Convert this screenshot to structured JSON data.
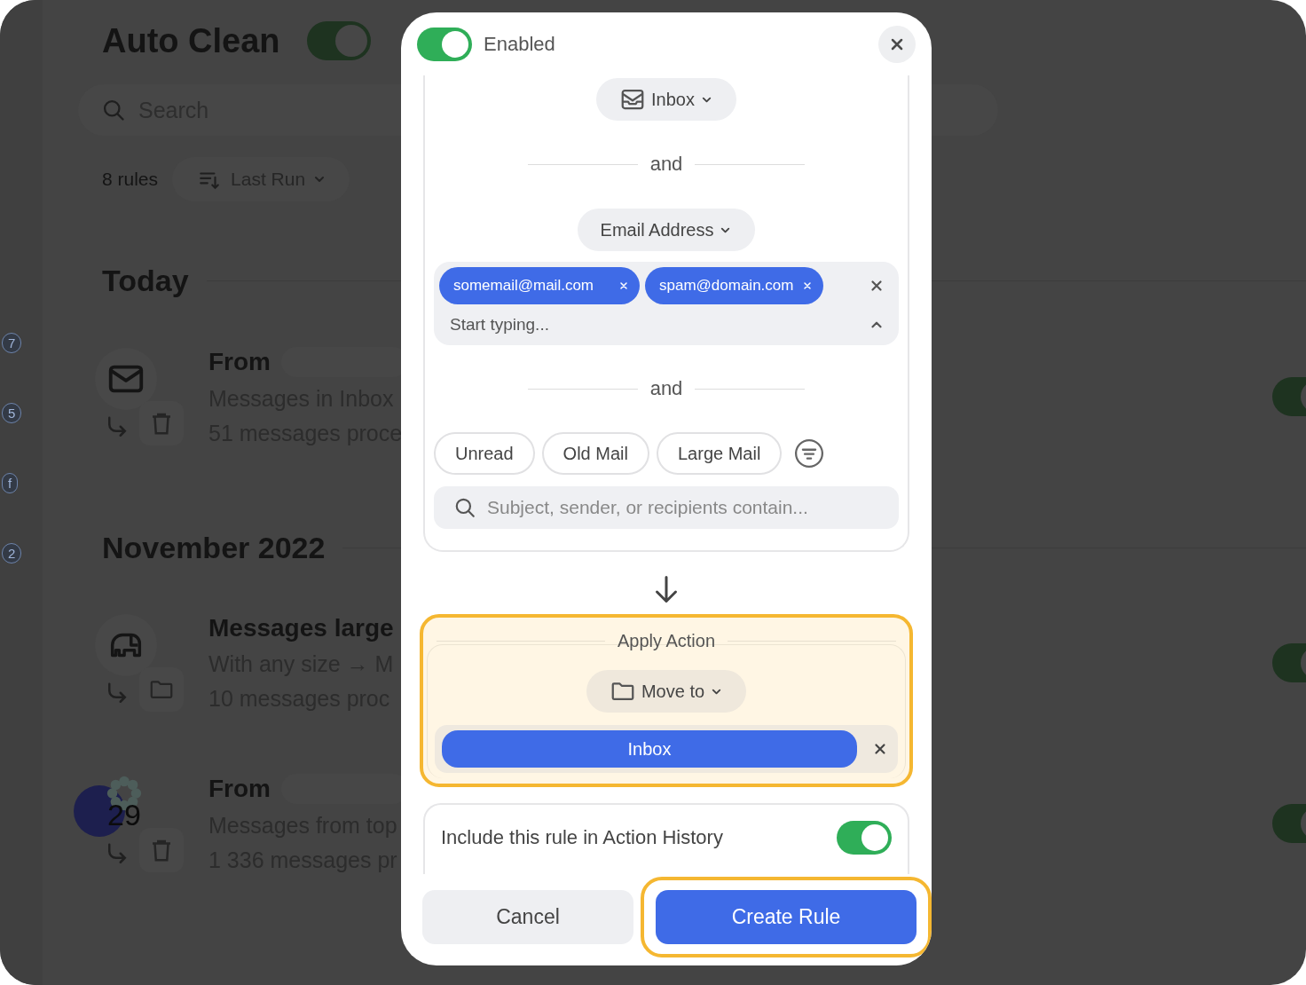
{
  "app": {
    "title": "Auto Clean",
    "enabled": true,
    "search": {
      "placeholder": "Search"
    },
    "rule_count": "8 rules",
    "sort": {
      "label": "Last Run"
    },
    "sidebar_badges": [
      "7",
      "5",
      "f",
      "2"
    ],
    "sections": [
      {
        "heading": "Today",
        "rules": [
          {
            "kind": "inbox-delete",
            "title": "From",
            "redacted": true,
            "description": "Messages in Inbox",
            "stats": "51 messages proce",
            "enabled": true
          }
        ]
      },
      {
        "heading": "November 2022",
        "rules": [
          {
            "kind": "large-move",
            "title": "Messages large",
            "redacted": false,
            "description": "With any size → M",
            "stats": "10 messages proc",
            "enabled": true
          },
          {
            "kind": "sender-delete",
            "title": "From",
            "redacted": true,
            "badge": "29",
            "description": "Messages from top",
            "stats": "1 336 messages pr",
            "enabled": true
          }
        ]
      }
    ]
  },
  "dialog": {
    "enabled": true,
    "enabled_label": "Enabled",
    "conditions": [
      {
        "kind": "mailbox",
        "label": "Inbox"
      },
      {
        "kind": "separator",
        "label": "and"
      },
      {
        "kind": "dropdown",
        "label": "Email Address"
      },
      {
        "kind": "tags",
        "tags": [
          "somemail@mail.com",
          "spam@domain.com"
        ],
        "placeholder": "Start typing...",
        "expanded": true
      },
      {
        "kind": "separator",
        "label": "and"
      },
      {
        "kind": "chips",
        "chips": [
          {
            "label": "Unread",
            "selected": false
          },
          {
            "label": "Old Mail",
            "selected": false
          },
          {
            "label": "Large Mail",
            "selected": false
          }
        ]
      },
      {
        "kind": "search",
        "placeholder": "Subject, sender, or recipients contain..."
      }
    ],
    "action": {
      "legend": "Apply Action",
      "highlighted": true,
      "dropdown": {
        "label": "Move to"
      },
      "target": "Inbox"
    },
    "history": {
      "label": "Include this rule in Action History",
      "on": true
    },
    "buttons": [
      {
        "kind": "secondary",
        "label": "Cancel",
        "highlighted": false
      },
      {
        "kind": "primary",
        "label": "Create Rule",
        "highlighted": true
      }
    ]
  }
}
